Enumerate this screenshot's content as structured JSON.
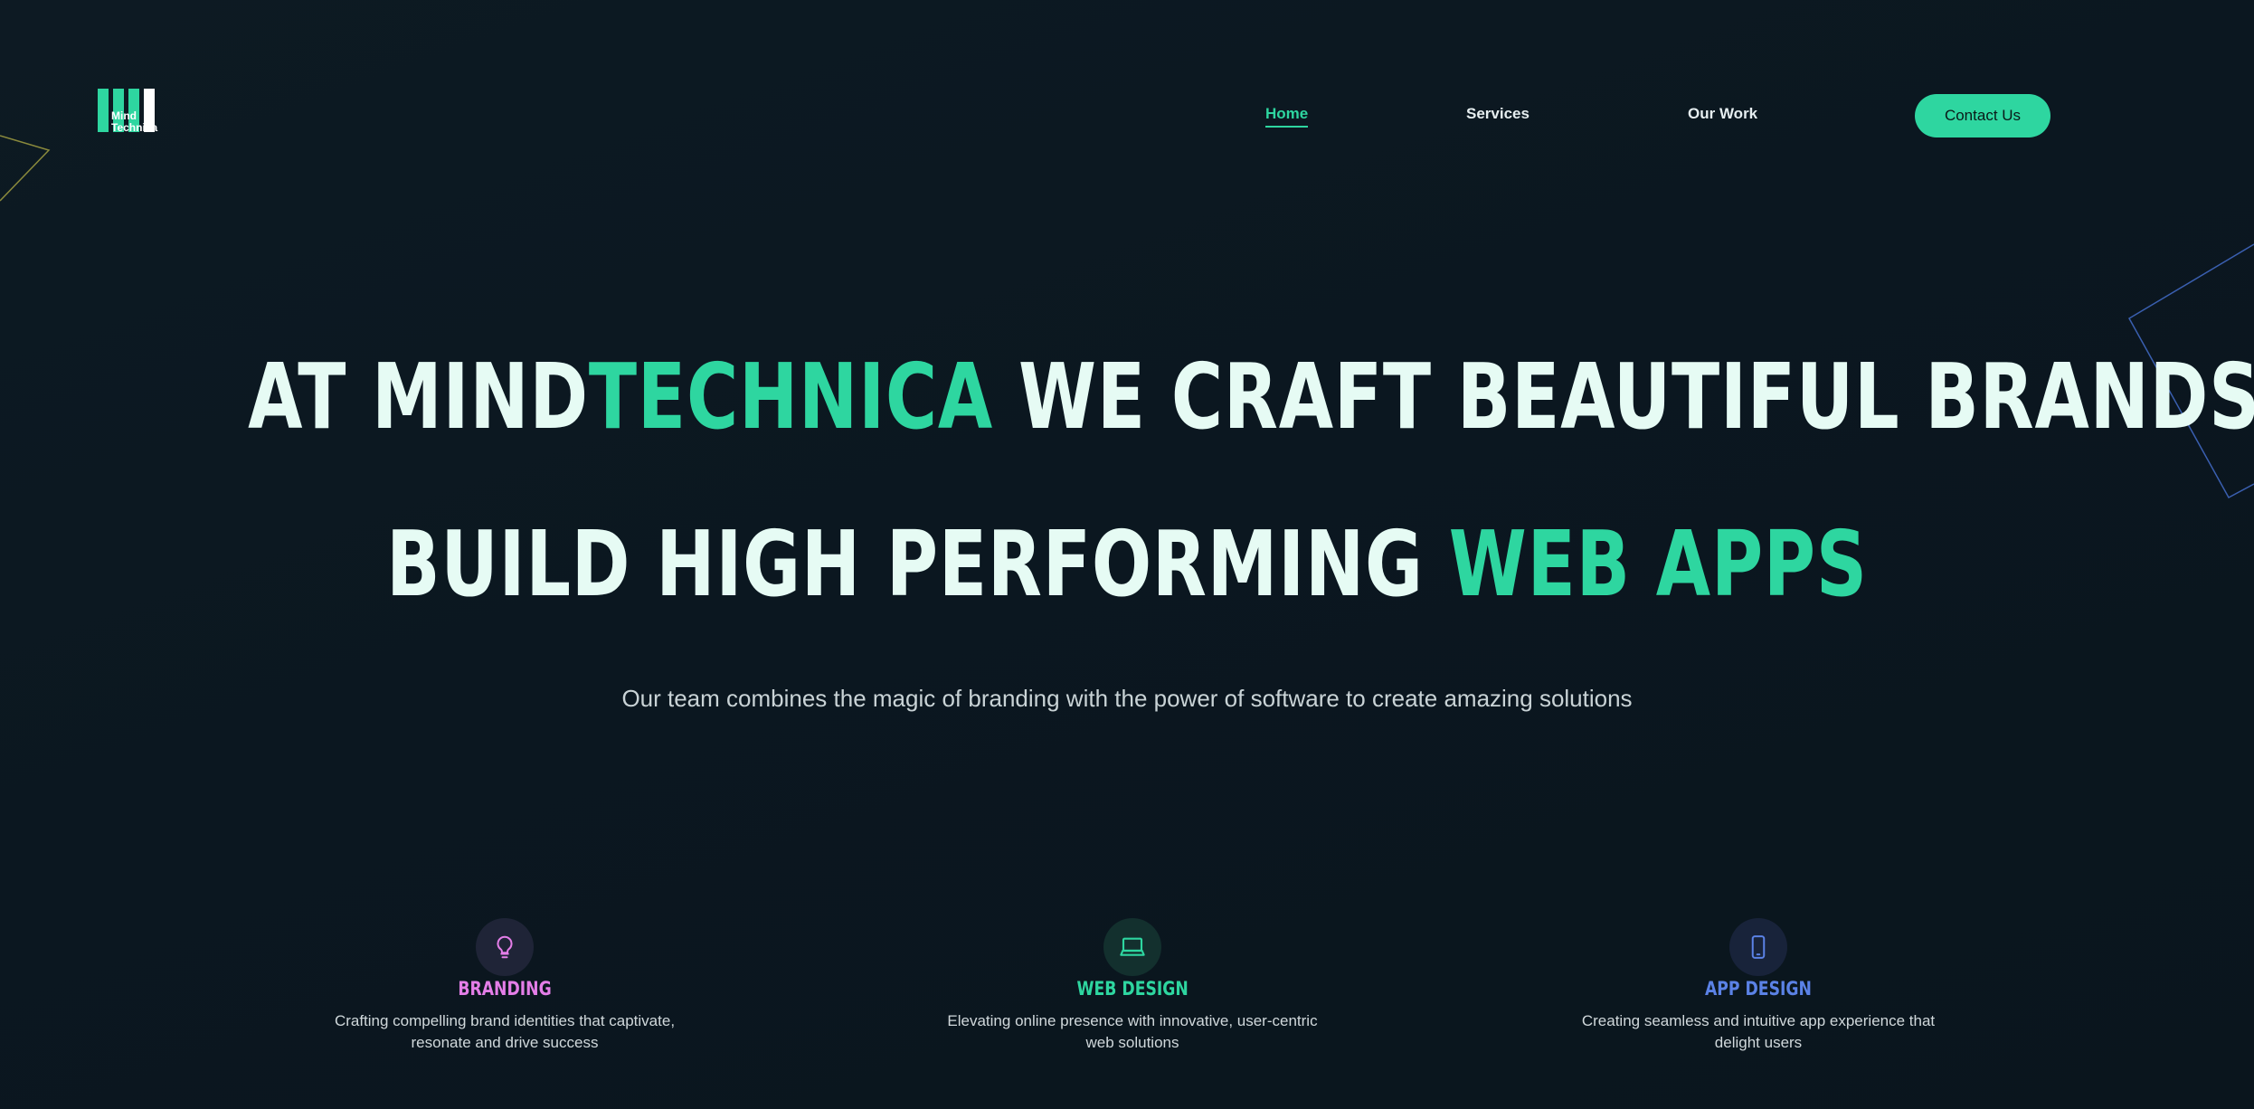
{
  "colors": {
    "accent": "#2ed6a0",
    "background": "#0c1821",
    "branding": "#e47ee8",
    "app": "#5b82e6"
  },
  "logo": {
    "line1": "Mind",
    "line2": "Technica"
  },
  "nav": {
    "home": "Home",
    "services": "Services",
    "work": "Our Work",
    "contact": "Contact Us"
  },
  "hero": {
    "line1_a": "AT MIND",
    "line1_b": "TECHNICA",
    "line1_c": " WE CRAFT BEAUTIFUL BRANDS AND WE",
    "line2_a": "BUILD HIGH PERFORMING ",
    "line2_b": "WEB APPS",
    "subtitle": "Our team combines the magic of branding with the power of software to create amazing solutions"
  },
  "services": [
    {
      "icon": "lightbulb-icon",
      "title": "BRANDING",
      "desc": "Crafting compelling brand identities that captivate, resonate and drive success"
    },
    {
      "icon": "laptop-icon",
      "title": "WEB DESIGN",
      "desc": "Elevating online presence with innovative, user-centric web solutions"
    },
    {
      "icon": "smartphone-icon",
      "title": "APP DESIGN",
      "desc": "Creating seamless and intuitive app experience that delight users"
    }
  ]
}
